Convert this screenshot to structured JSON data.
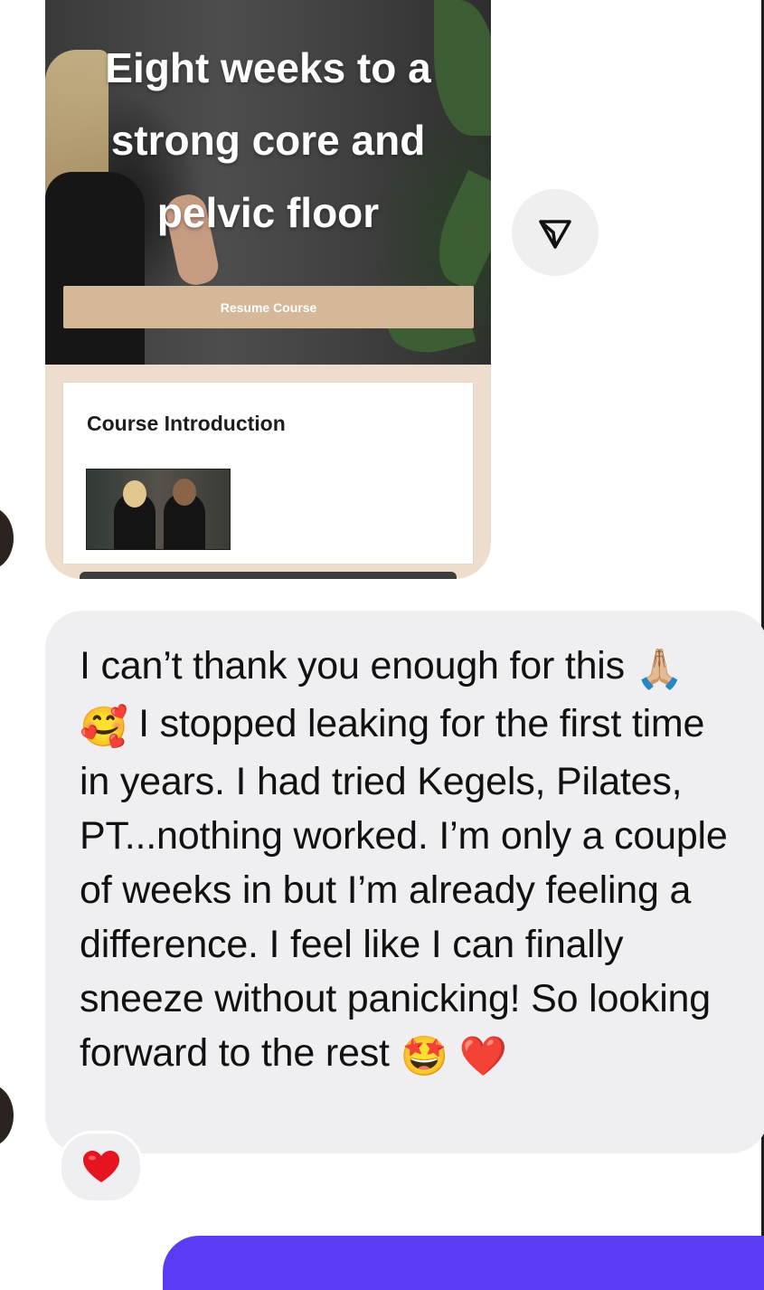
{
  "shared_course": {
    "title_lines": [
      "Eight weeks to a",
      "strong core and",
      "pelvic floor"
    ],
    "resume_label": "Resume Course",
    "section_title": "Course Introduction"
  },
  "message": {
    "text_part1": "I can’t thank you enough for this ",
    "emoji1": "🙏🏼",
    "emoji2": "🥰",
    "text_part2": " I stopped leaking for the first time in years. I had tried Kegels, Pilates, PT...nothing worked. I’m only a couple of weeks in but I’m already feeling a difference. I feel like I can finally sneeze without panicking! So looking forward to the rest ",
    "emoji3": "🤩",
    "emoji4": "❤️"
  },
  "reaction": {
    "emoji": "❤️"
  },
  "icons": {
    "share": "paper-plane-icon",
    "reaction": "red-heart-icon"
  },
  "colors": {
    "bubble": "#efeff2",
    "resume_button": "#d4b898",
    "card_background": "#eedccd",
    "composer_accent": "#5b3bf3"
  }
}
